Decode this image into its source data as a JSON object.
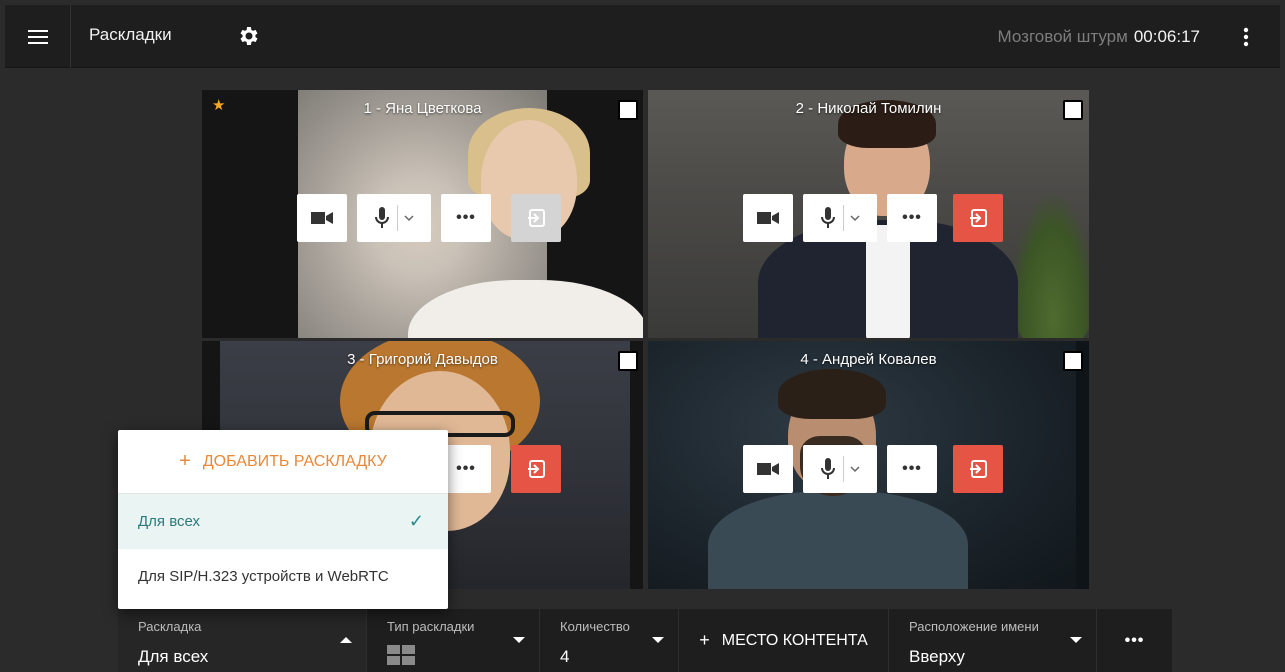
{
  "header": {
    "title": "Раскладки",
    "conference_name": "Мозговой штурм",
    "timer": "00:06:17"
  },
  "tiles": [
    {
      "name": "1 - Яна Цветкова",
      "starred": true,
      "exit_enabled": false
    },
    {
      "name": "2 - Николай Томилин",
      "starred": false,
      "exit_enabled": true
    },
    {
      "name": "3 - Григорий Давыдов",
      "starred": false,
      "exit_enabled": true
    },
    {
      "name": "4 - Андрей Ковалев",
      "starred": false,
      "exit_enabled": true
    }
  ],
  "popup": {
    "add_label": "ДОБАВИТЬ РАСКЛАДКУ",
    "items": [
      {
        "label": "Для всех",
        "selected": true
      },
      {
        "label": "Для SIP/H.323 устройств и WebRTC",
        "selected": false
      }
    ]
  },
  "toolbar": {
    "layout_label": "Раскладка",
    "layout_value": "Для всех",
    "type_label": "Тип раскладки",
    "count_label": "Количество",
    "count_value": "4",
    "content_label": "МЕСТО КОНТЕНТА",
    "name_pos_label": "Расположение имени",
    "name_pos_value": "Вверху"
  },
  "colors": {
    "accent_orange": "#e8883a",
    "exit_red": "#e55444",
    "star": "#f5a623",
    "selected_teal": "#2a7b7b"
  }
}
